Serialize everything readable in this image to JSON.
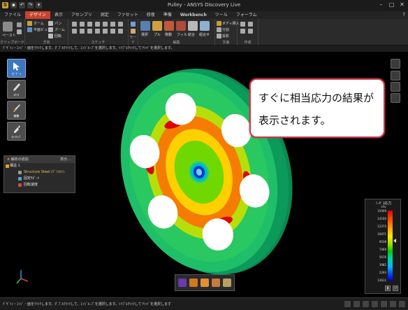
{
  "titlebar": {
    "title": "Pulley - ANSYS Discovery Live"
  },
  "menu": {
    "tabs": [
      "ファイル",
      "デザイン",
      "表示",
      "アセンブリ",
      "測定",
      "ファセット",
      "修復",
      "準備",
      "Workbench",
      "ツール",
      "フォーラム"
    ],
    "active_index": 1
  },
  "ribbon": {
    "groups": [
      {
        "label": "クリップボード",
        "items": [
          "ペースト"
        ]
      },
      {
        "label": "方向",
        "items": [
          "ホーム",
          "平面ビュー",
          "ズーム",
          "パン",
          "回転"
        ]
      },
      {
        "label": "スケッチ",
        "items": []
      },
      {
        "label": "モード",
        "items": []
      },
      {
        "label": "編集",
        "items": [
          "選択",
          "プル",
          "移動",
          "フィル",
          "結合",
          "組合せ"
        ]
      },
      {
        "label": "交差",
        "items": [
          "ボディ挿入",
          "分割",
          "投影"
        ]
      },
      {
        "label": "作成",
        "items": []
      }
    ]
  },
  "statusline": "ﾃﾞｻﾞｲﾝ・ｴｯｼﾞ・面をｸﾘｯｸします。ﾀﾞﾌﾞﾙｸﾘｯｸして、ｴｯｼﾞﾙｰﾌﾟを選択します。ﾄﾘﾌﾟﾙｸﾘｯｸしてｿﾘｯﾄﾞを選択します。",
  "left_tools": [
    {
      "label": "ﾅﾋﾞｹﾞｰﾄ",
      "icon": "cursor-icon"
    },
    {
      "label": "ｽｹｯﾁ",
      "icon": "pencil-icon"
    },
    {
      "label": "編集",
      "icon": "brush-icon"
    },
    {
      "label": "ｾｯﾄｱｯﾌﾟ",
      "icon": "wrench-icon"
    }
  ],
  "tree": {
    "header": "解析の追加",
    "view_label": "表示...",
    "items": [
      {
        "label": "構造 1"
      },
      {
        "label": "Structure Steel (ﾃﾞﾌｫﾙﾄ)"
      },
      {
        "label": "固定ｻﾎﾟｰﾄ"
      },
      {
        "label": "回転速度"
      }
    ]
  },
  "legend": {
    "title": "ﾐｰｾﾞｽ応力",
    "unit": "kPa",
    "ticks": [
      "15909",
      "14100",
      "12375",
      "10871",
      "9038",
      "7469",
      "5676",
      "3985",
      "2293",
      "13611"
    ]
  },
  "callout": {
    "line1": "すぐに相当応力の結果が",
    "line2": "表示されます。"
  },
  "statusbar": {
    "text": "ﾃﾞｻﾞｲﾝ・ｴｯｼﾞ・面をｸﾘｯｸします。ﾀﾞﾌﾞﾙｸﾘｯｸして、ｴｯｼﾞﾙｰﾌﾟを選択します。ﾄﾘﾌﾟﾙｸﾘｯｸしてｿﾘｯﾄﾞを選択します"
  }
}
